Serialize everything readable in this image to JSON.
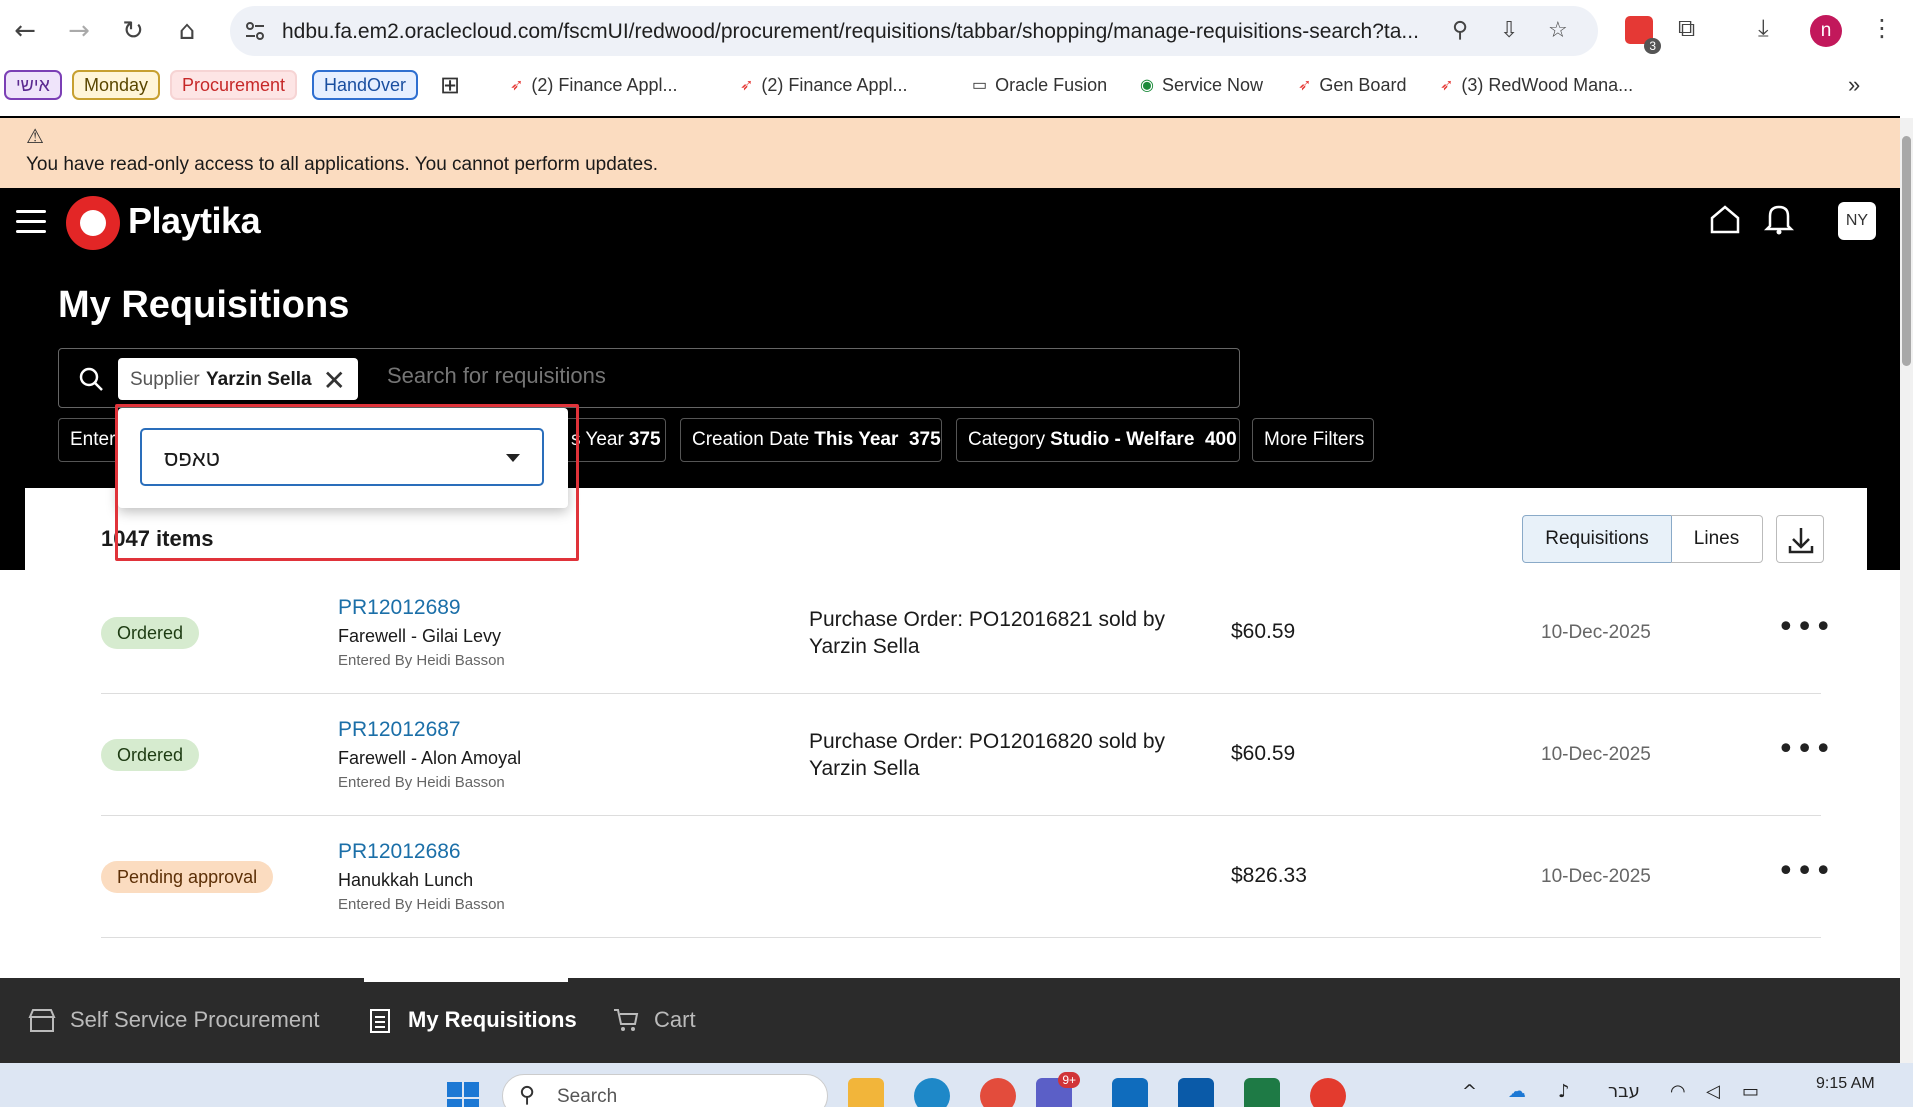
{
  "browser": {
    "url": "hdbu.fa.em2.oraclecloud.com/fscmUI/redwood/procurement/requisitions/tabbar/shopping/manage-requisitions-search?ta...",
    "extension_badge": "3",
    "profile_initial": "n",
    "bookmarks": {
      "tags": [
        "אישי",
        "Monday",
        "Procurement",
        "HandOver"
      ],
      "links": [
        "(2) Finance Appl...",
        "(2) Finance Appl...",
        "Oracle Fusion",
        "Service Now",
        "Gen Board",
        "(3) RedWood Mana..."
      ],
      "overflow": "»"
    }
  },
  "banner": {
    "text": "You have read-only access to all applications. You cannot perform updates."
  },
  "header": {
    "brand": "Playtika",
    "user_initials": "NY"
  },
  "page": {
    "title": "My Requisitions"
  },
  "search": {
    "chip_key": "Supplier",
    "chip_value": "Yarzin Sella",
    "placeholder": "Search for requisitions"
  },
  "filters": [
    {
      "label": "Enter",
      "value": ""
    },
    {
      "label": "s Year",
      "value": "375"
    },
    {
      "label": "Creation Date",
      "value": "This Year  375"
    },
    {
      "label": "Category",
      "value": "Studio - Welfare  400"
    },
    {
      "label": "More Filters",
      "value": ""
    }
  ],
  "popup": {
    "input_value": "טאפס"
  },
  "results": {
    "count_text": "1047 items",
    "view_requisitions": "Requisitions",
    "view_lines": "Lines",
    "rows": [
      {
        "status": "Ordered",
        "number": "PR12012689",
        "description": "Farewell - Gilai Levy",
        "entered_by": "Entered By Heidi Basson",
        "po_info": "Purchase Order: PO12016821 sold by Yarzin Sella",
        "amount": "$60.59",
        "date": "10-Dec-2025"
      },
      {
        "status": "Ordered",
        "number": "PR12012687",
        "description": "Farewell - Alon Amoyal",
        "entered_by": "Entered By Heidi Basson",
        "po_info": "Purchase Order: PO12016820 sold by Yarzin Sella",
        "amount": "$60.59",
        "date": "10-Dec-2025"
      },
      {
        "status": "Pending approval",
        "number": "PR12012686",
        "description": "Hanukkah Lunch",
        "entered_by": "Entered By Heidi Basson",
        "po_info": "",
        "amount": "$826.33",
        "date": "10-Dec-2025"
      }
    ]
  },
  "tabs": {
    "self_service": "Self Service Procurement",
    "my_requisitions": "My Requisitions",
    "cart": "Cart"
  },
  "taskbar": {
    "search_placeholder": "Search",
    "language": "עבר",
    "time": "9:15 AM",
    "teams_badge": "9+"
  },
  "colors": {
    "accent_blue": "#1b6fa8",
    "highlight_red": "#e0333a",
    "banner_bg": "#fbdcc0",
    "ordered_bg": "#d6ebcf",
    "pending_bg": "#fbdcc0"
  }
}
